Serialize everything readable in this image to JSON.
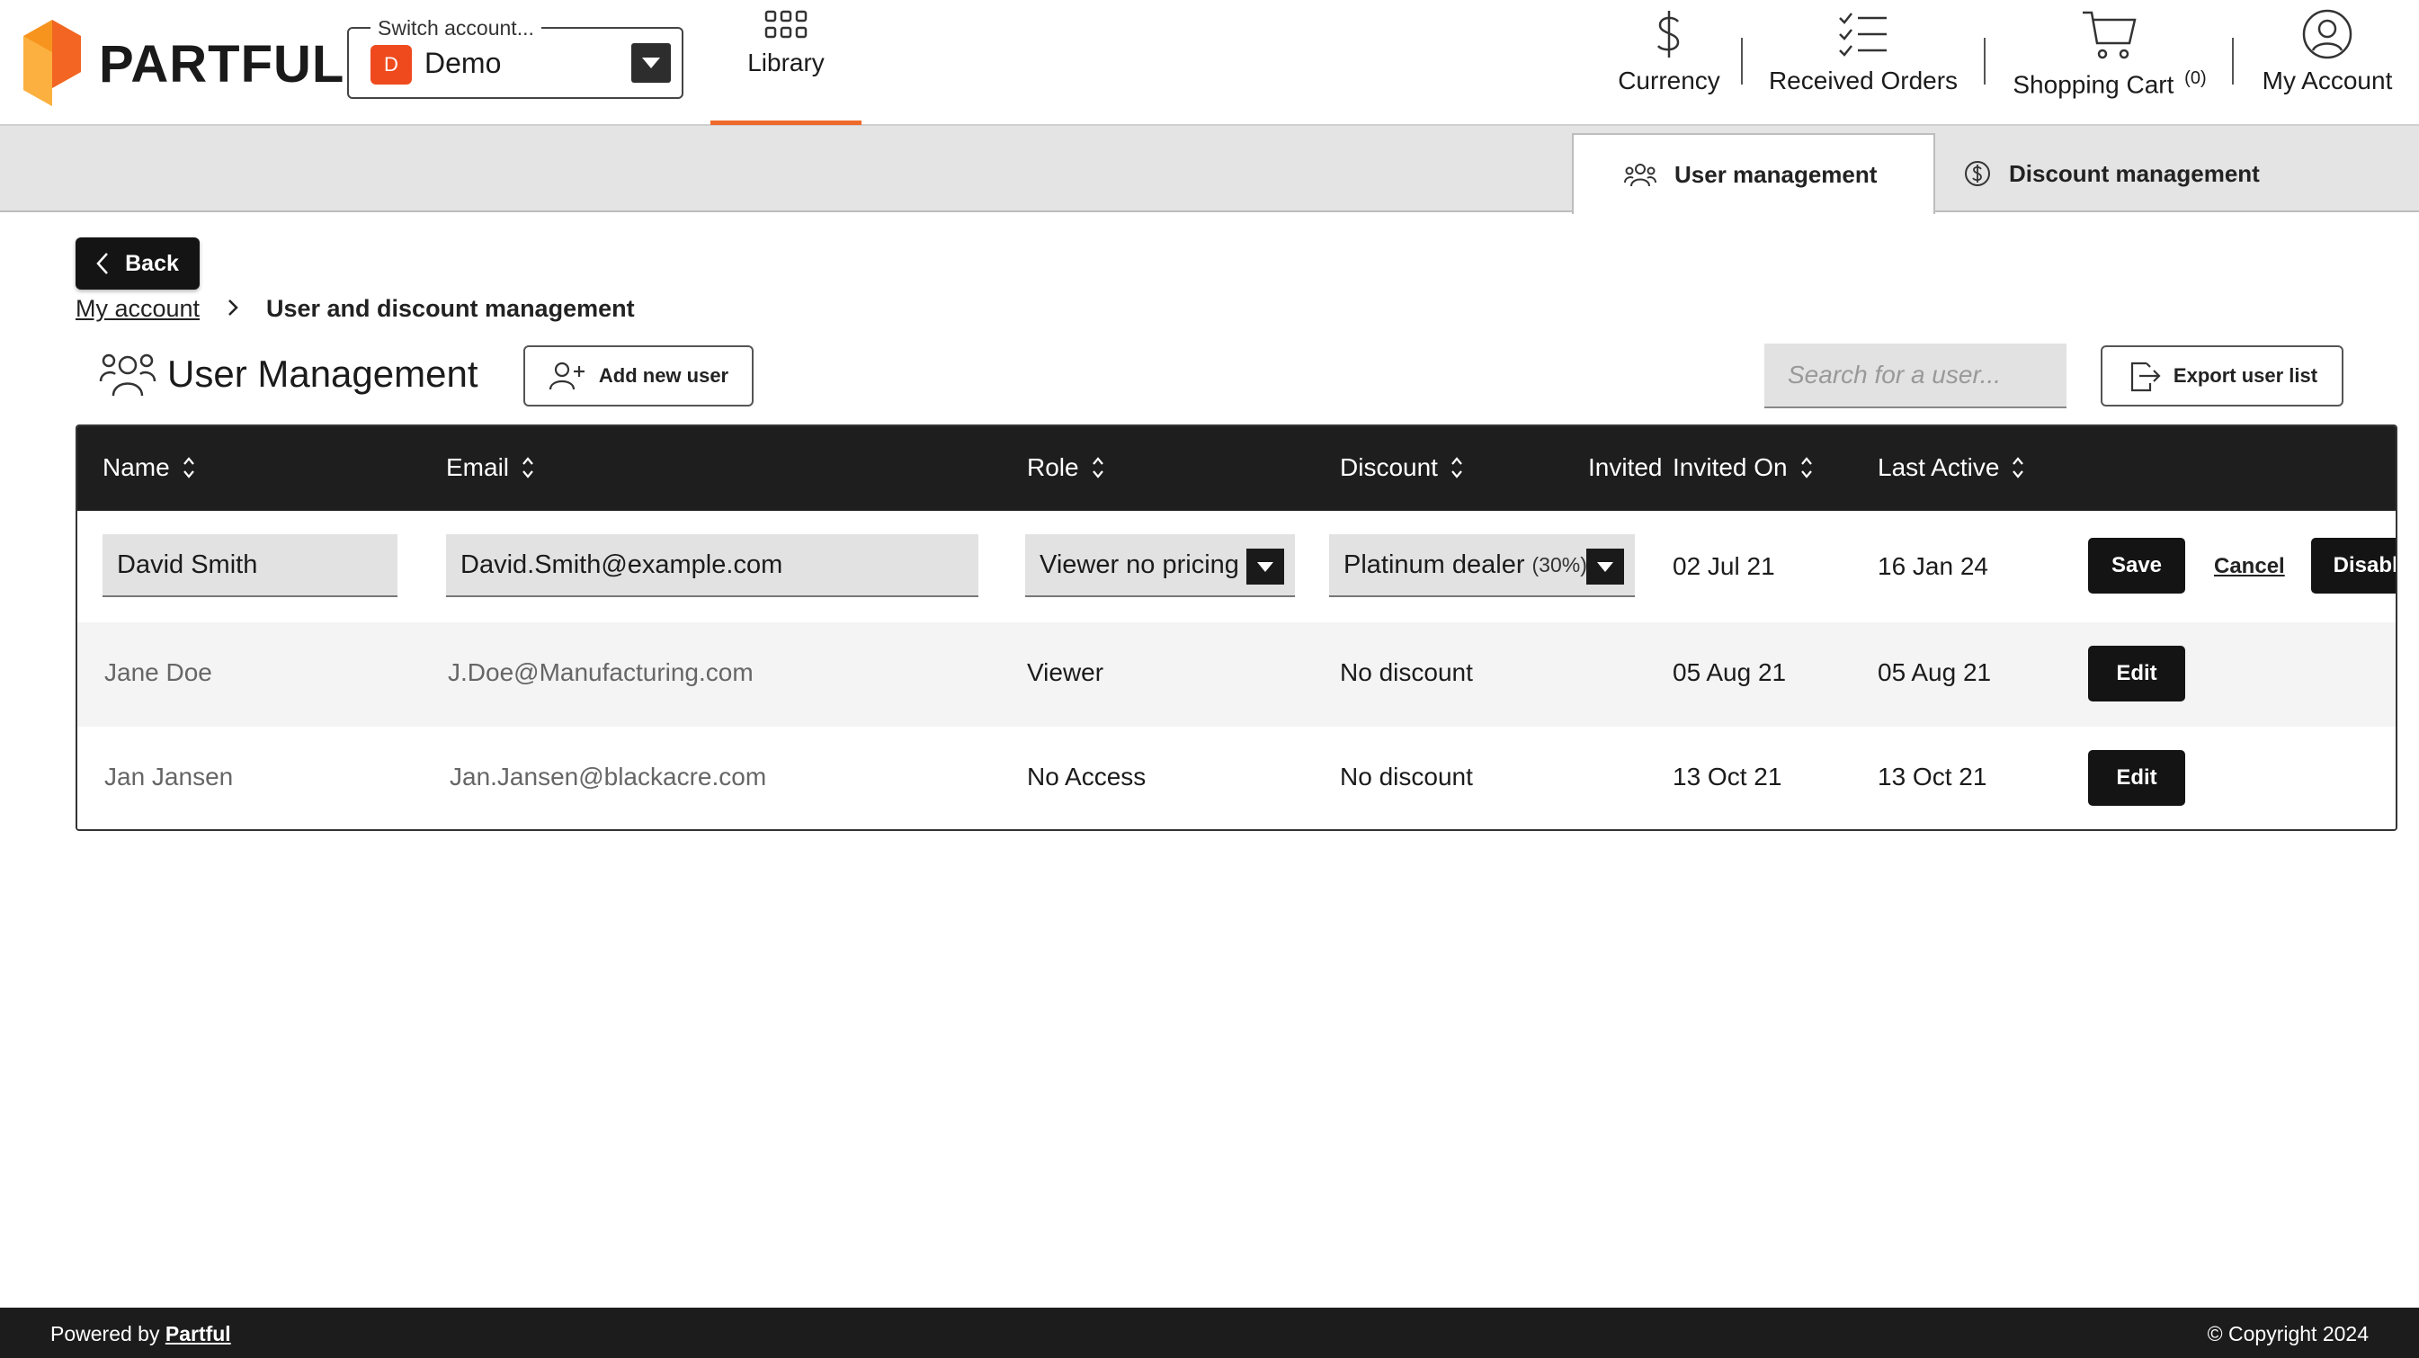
{
  "header": {
    "brand": "PARTFUL",
    "switch_account": {
      "legend": "Switch account...",
      "avatar_letter": "D",
      "name": "Demo"
    },
    "nav": {
      "library": "Library",
      "currency": "Currency",
      "received_orders": "Received Orders",
      "shopping_cart": "Shopping Cart",
      "cart_count": "(0)",
      "my_account": "My Account"
    },
    "colors": {
      "brand_orange": "#ef6a2a",
      "avatar_red": "#ef4a1e"
    }
  },
  "tabs": {
    "user_management": "User management",
    "discount_management": "Discount management"
  },
  "page": {
    "back": "Back",
    "breadcrumb_link": "My account",
    "breadcrumb_current": "User and discount management",
    "title": "User Management",
    "add_user": "Add new user",
    "search_placeholder": "Search for a user...",
    "export": "Export user list"
  },
  "table": {
    "headers": {
      "name": "Name",
      "email": "Email",
      "role": "Role",
      "discount": "Discount",
      "invited_on": "Invited On",
      "invited_on_overlap": "Invited",
      "last_active": "Last Active"
    },
    "rows": [
      {
        "name": "David Smith",
        "email": "David.Smith@example.com",
        "role": "Viewer no pricing",
        "discount": "Platinum dealer",
        "discount_pct": "(30%)",
        "invited_on": "02 Jul 21",
        "last_active": "16 Jan 24",
        "save": "Save",
        "cancel": "Cancel",
        "disable": "Disable"
      },
      {
        "name": "Jane Doe",
        "email": "J.Doe@Manufacturing.com",
        "role": "Viewer",
        "discount": "No discount",
        "invited_on": "05 Aug 21",
        "last_active": "05 Aug 21",
        "edit": "Edit"
      },
      {
        "name": "Jan Jansen",
        "email": "Jan.Jansen@blackacre.com",
        "role": "No Access",
        "discount": "No discount",
        "invited_on": "13 Oct 21",
        "last_active": "13 Oct 21",
        "edit": "Edit"
      }
    ]
  },
  "footer": {
    "powered_by": "Powered by",
    "powered_link": "Partful",
    "copyright": "© Copyright 2024"
  }
}
